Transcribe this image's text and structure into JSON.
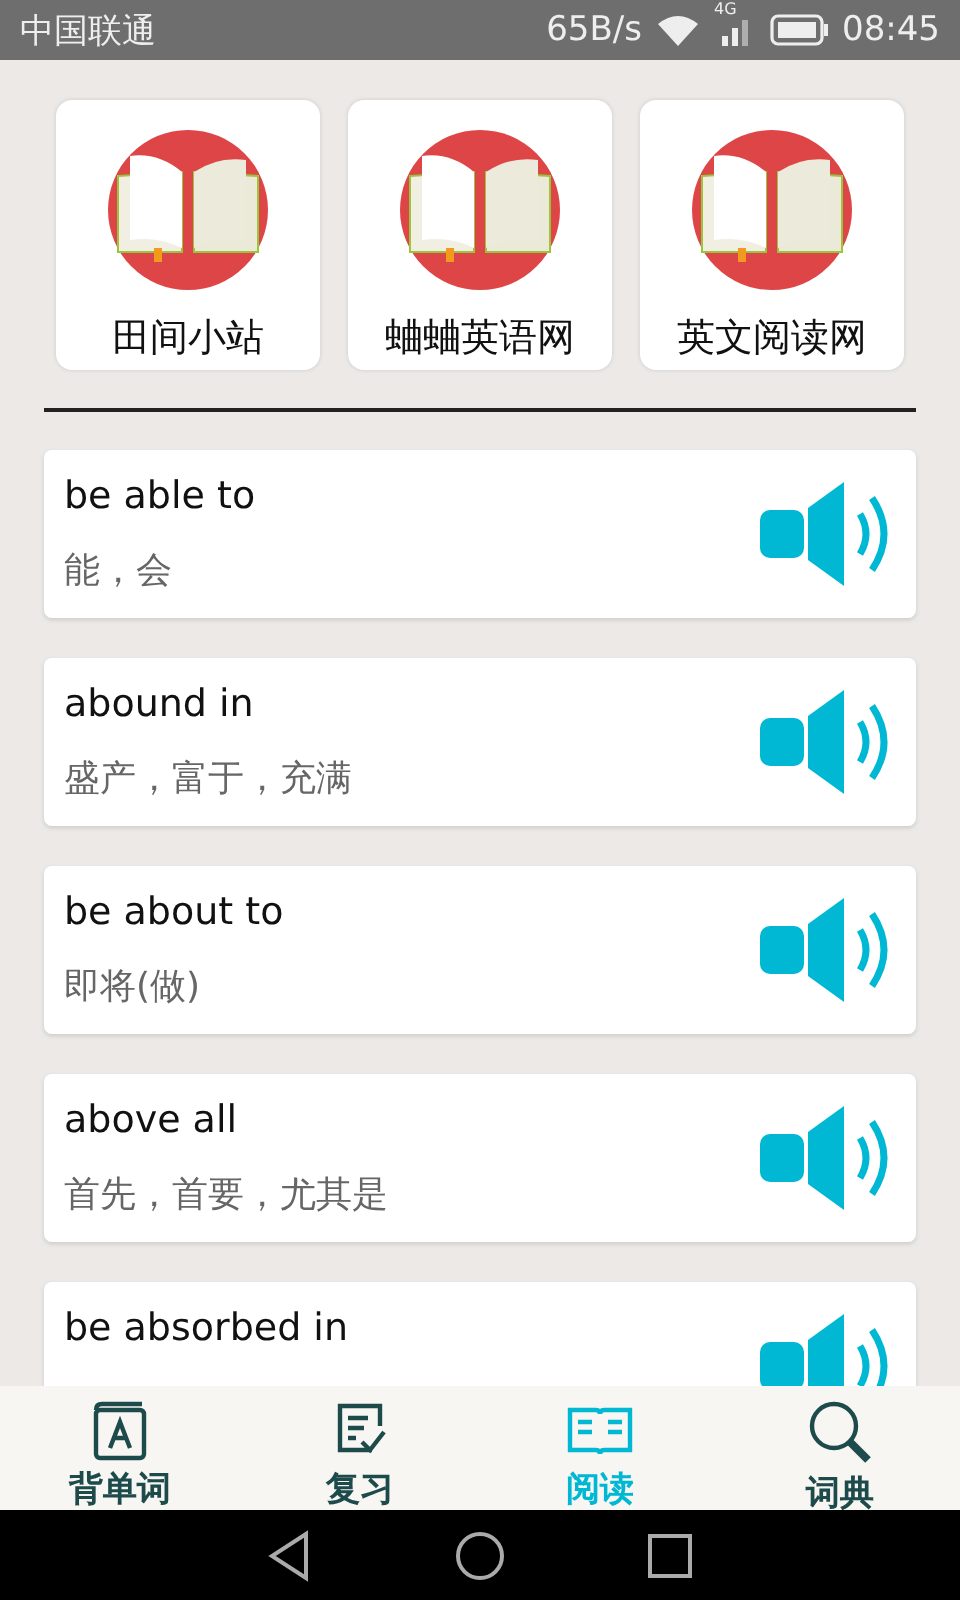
{
  "status_bar": {
    "carrier": "中国联通",
    "speed": "65B/s",
    "network": "4G",
    "time": "08:45"
  },
  "sites": [
    {
      "label": "田间小站"
    },
    {
      "label": "蛐蛐英语网"
    },
    {
      "label": "英文阅读网"
    }
  ],
  "words": [
    {
      "word": "be able to",
      "meaning": "能，会"
    },
    {
      "word": "abound in",
      "meaning": "盛产，富于，充满"
    },
    {
      "word": "be about to",
      "meaning": "即将(做)"
    },
    {
      "word": "above all",
      "meaning": "首先，首要，尤其是"
    },
    {
      "word": "be absorbed in"
    }
  ],
  "bottom_nav": [
    {
      "label": "背单词",
      "kind": "card",
      "selected": false
    },
    {
      "label": "复习",
      "kind": "review",
      "selected": false
    },
    {
      "label": "阅读",
      "kind": "book",
      "selected": true
    },
    {
      "label": "词典",
      "kind": "search",
      "selected": false
    }
  ]
}
